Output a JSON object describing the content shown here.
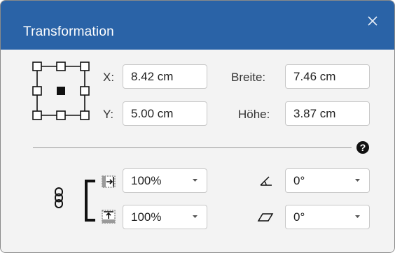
{
  "window": {
    "title": "Transformation"
  },
  "position": {
    "x_label": "X:",
    "x_value": "8.42 cm",
    "y_label": "Y:",
    "y_value": "5.00 cm"
  },
  "size": {
    "width_label": "Breite:",
    "width_value": "7.46 cm",
    "height_label": "Höhe:",
    "height_value": "3.87 cm"
  },
  "help": {
    "label": "?"
  },
  "scale": {
    "horizontal_value": "100%",
    "vertical_value": "100%"
  },
  "angles": {
    "rotation_value": "0°",
    "skew_value": "0°"
  },
  "icons": {
    "close": "close-icon",
    "anchor": "anchor-grid-icon",
    "link": "chain-link-icon",
    "hscale": "horizontal-scale-icon",
    "vscale": "vertical-scale-icon",
    "rotate": "rotate-angle-icon",
    "skew": "skew-icon"
  },
  "colors": {
    "titlebar": "#2a63a7",
    "background": "#f3f3f3",
    "field_border": "#c8c8c8"
  }
}
